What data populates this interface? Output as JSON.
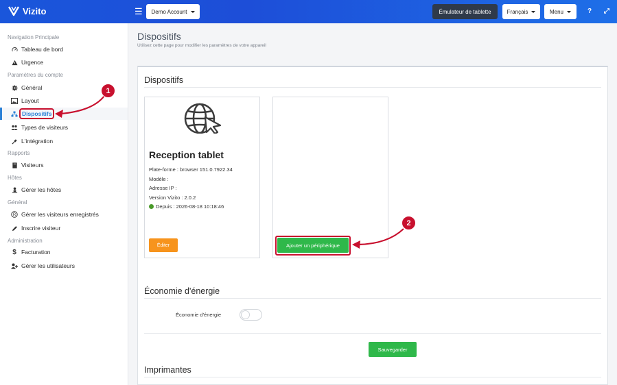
{
  "header": {
    "brand": "Vizito",
    "account_label": "Demo Account",
    "emulator_label": "Émulateur de tablette",
    "language_label": "Français",
    "menu_label": "Menu",
    "help_icon": "?",
    "expand_icon": "⤢"
  },
  "sidebar": {
    "sections": [
      {
        "title": "Navigation Principale"
      },
      {
        "title": "Paramètres du compte"
      },
      {
        "title": "Rapports"
      },
      {
        "title": "Hôtes"
      },
      {
        "title": "Général"
      },
      {
        "title": "Administration"
      }
    ],
    "items": [
      {
        "label": "Tableau de bord",
        "icon": "dashboard-icon"
      },
      {
        "label": "Urgence",
        "icon": "warning-icon"
      },
      {
        "label": "Général",
        "icon": "gear-icon"
      },
      {
        "label": "Layout",
        "icon": "image-icon"
      },
      {
        "label": "Dispositifs",
        "icon": "devices-icon"
      },
      {
        "label": "Types de visiteurs",
        "icon": "users-icon"
      },
      {
        "label": "L'intégration",
        "icon": "plug-icon"
      },
      {
        "label": "Visiteurs",
        "icon": "book-icon"
      },
      {
        "label": "Gérer les hôtes",
        "icon": "person-icon"
      },
      {
        "label": "Gérer les visiteurs enregistrés",
        "icon": "registered-icon"
      },
      {
        "label": "Inscrire visiteur",
        "icon": "pencil-icon"
      },
      {
        "label": "Facturation",
        "icon": "dollar-icon"
      },
      {
        "label": "Gérer les utilisateurs",
        "icon": "user-plus-icon"
      }
    ],
    "active_item": "Dispositifs"
  },
  "page": {
    "title": "Dispositifs",
    "subtitle": "Utilisez cette page pour modifier les paramètres de votre appareil"
  },
  "devices_section": {
    "title": "Dispositifs",
    "device": {
      "name": "Reception tablet",
      "platform": "Plate-forme : browser 151.0.7922.34",
      "model": "Modèle :",
      "ip": "Adresse IP :",
      "version": "Version Vizito : 2.0.2",
      "since": "Depuis : 2026-08-18 10:18:46",
      "status_color": "#4a9a2a",
      "edit_label": "Éditer"
    },
    "add_label": "Ajouter un périphérique"
  },
  "energy_section": {
    "title": "Économie d'énergie",
    "toggle_label": "Économie d'énergie",
    "toggle_on": false,
    "save_label": "Sauvegarder"
  },
  "printers_section": {
    "title": "Imprimantes"
  },
  "annotations": {
    "badge1": "1",
    "badge2": "2",
    "color": "#c8102e"
  }
}
